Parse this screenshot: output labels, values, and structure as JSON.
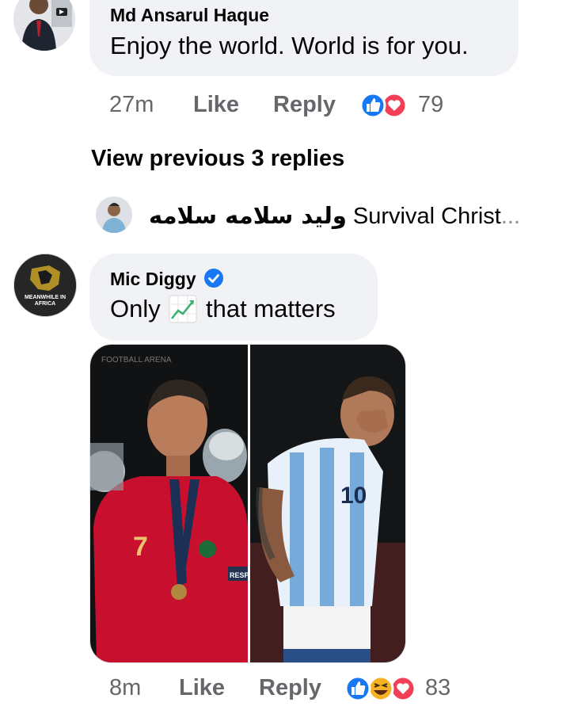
{
  "comment1": {
    "author": "Md Ansarul Haque",
    "text": "Enjoy the world. World is for you.",
    "time": "27m",
    "like_label": "Like",
    "reply_label": "Reply",
    "reactions": [
      "like-icon",
      "love-icon"
    ],
    "reaction_count": "79"
  },
  "replies": {
    "view_previous": "View previous 3 replies",
    "preview_author": "وليد سلامه سلامه",
    "preview_text": "Survival Christ",
    "preview_ellipsis": "..."
  },
  "comment2": {
    "author": "Mic Diggy",
    "verified_icon": "verified-badge-icon",
    "text_before": "Only",
    "emoji": "chart-increasing-icon",
    "text_after": "that matters",
    "avatar_text": "MEANWHILE IN AFRICA",
    "image_watermark": "FOOTBALL ARENA",
    "image_left_number": "7",
    "image_right_number": "10",
    "image_armband_text": "RESP",
    "time": "8m",
    "like_label": "Like",
    "reply_label": "Reply",
    "reactions": [
      "like-icon",
      "haha-icon",
      "love-icon"
    ],
    "reaction_count": "83"
  },
  "colors": {
    "bubble": "#f0f2f5",
    "secondary_text": "#65676b",
    "like_blue": "#1877f2",
    "love_red": "#f33e58",
    "haha_yellow": "#f7b125",
    "verified_blue": "#1877f2",
    "portugal_red": "#c8102e",
    "argentina_blue": "#75aadb"
  }
}
